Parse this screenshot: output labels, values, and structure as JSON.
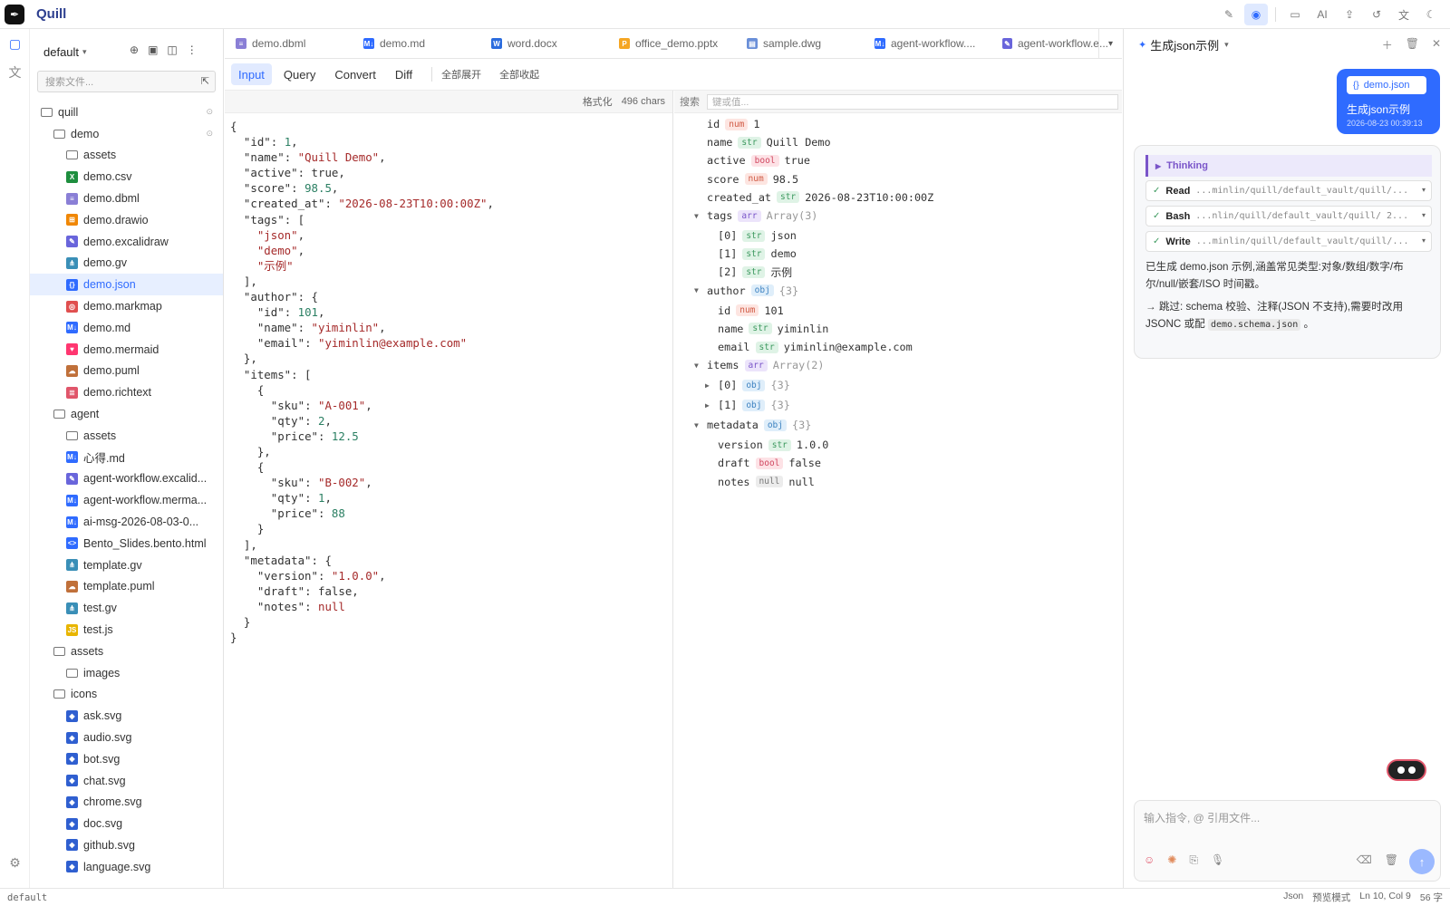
{
  "app": {
    "title": "Quill"
  },
  "topbar": {
    "actions": [
      {
        "name": "edit-icon",
        "glyph": "✎",
        "active": false
      },
      {
        "name": "preview-icon",
        "glyph": "◉",
        "active": true
      },
      {
        "name": "terminal-icon",
        "glyph": "▭",
        "active": false
      },
      {
        "name": "ai-icon",
        "glyph": "AI",
        "active": false
      },
      {
        "name": "share-icon",
        "glyph": "⇪",
        "active": false
      },
      {
        "name": "history-icon",
        "glyph": "↺",
        "active": false
      },
      {
        "name": "translate-icon",
        "glyph": "文",
        "active": false
      },
      {
        "name": "theme-icon",
        "glyph": "☾",
        "active": false
      }
    ]
  },
  "sidebar": {
    "vault": "default",
    "search_placeholder": "搜索文件...",
    "tree": [
      {
        "label": "quill",
        "depth": 0,
        "icon": "folder",
        "pin": true
      },
      {
        "label": "demo",
        "depth": 1,
        "icon": "folder",
        "pin": true
      },
      {
        "label": "assets",
        "depth": 2,
        "icon": "folder"
      },
      {
        "label": "demo.csv",
        "depth": 2,
        "icon": "csv"
      },
      {
        "label": "demo.dbml",
        "depth": 2,
        "icon": "dbml"
      },
      {
        "label": "demo.drawio",
        "depth": 2,
        "icon": "drawio"
      },
      {
        "label": "demo.excalidraw",
        "depth": 2,
        "icon": "excalidraw"
      },
      {
        "label": "demo.gv",
        "depth": 2,
        "icon": "gv"
      },
      {
        "label": "demo.json",
        "depth": 2,
        "icon": "json",
        "selected": true
      },
      {
        "label": "demo.markmap",
        "depth": 2,
        "icon": "markmap"
      },
      {
        "label": "demo.md",
        "depth": 2,
        "icon": "md"
      },
      {
        "label": "demo.mermaid",
        "depth": 2,
        "icon": "mermaid"
      },
      {
        "label": "demo.puml",
        "depth": 2,
        "icon": "puml"
      },
      {
        "label": "demo.richtext",
        "depth": 2,
        "icon": "richtext"
      },
      {
        "label": "agent",
        "depth": 1,
        "icon": "folder"
      },
      {
        "label": "assets",
        "depth": 2,
        "icon": "folder"
      },
      {
        "label": "心得.md",
        "depth": 2,
        "icon": "md"
      },
      {
        "label": "agent-workflow.excalid...",
        "depth": 2,
        "icon": "excalidraw"
      },
      {
        "label": "agent-workflow.merma...",
        "depth": 2,
        "icon": "md"
      },
      {
        "label": "ai-msg-2026-08-03-0...",
        "depth": 2,
        "icon": "md"
      },
      {
        "label": "Bento_Slides.bento.html",
        "depth": 2,
        "icon": "html"
      },
      {
        "label": "template.gv",
        "depth": 2,
        "icon": "gv"
      },
      {
        "label": "template.puml",
        "depth": 2,
        "icon": "puml"
      },
      {
        "label": "test.gv",
        "depth": 2,
        "icon": "gv"
      },
      {
        "label": "test.js",
        "depth": 2,
        "icon": "js"
      },
      {
        "label": "assets",
        "depth": 1,
        "icon": "folder"
      },
      {
        "label": "images",
        "depth": 2,
        "icon": "folder"
      },
      {
        "label": "icons",
        "depth": 1,
        "icon": "folder"
      },
      {
        "label": "ask.svg",
        "depth": 2,
        "icon": "svg"
      },
      {
        "label": "audio.svg",
        "depth": 2,
        "icon": "svg"
      },
      {
        "label": "bot.svg",
        "depth": 2,
        "icon": "svg"
      },
      {
        "label": "chat.svg",
        "depth": 2,
        "icon": "svg"
      },
      {
        "label": "chrome.svg",
        "depth": 2,
        "icon": "svg"
      },
      {
        "label": "doc.svg",
        "depth": 2,
        "icon": "svg"
      },
      {
        "label": "github.svg",
        "depth": 2,
        "icon": "svg"
      },
      {
        "label": "language.svg",
        "depth": 2,
        "icon": "svg"
      }
    ]
  },
  "icon_styles": {
    "folder": {
      "glyph": "",
      "color": "#777777"
    },
    "csv": {
      "glyph": "X",
      "color": "#1e8e3e"
    },
    "dbml": {
      "glyph": "≡",
      "color": "#8a7fd6"
    },
    "drawio": {
      "glyph": "⊞",
      "color": "#f08705"
    },
    "excalidraw": {
      "glyph": "✎",
      "color": "#6965db"
    },
    "gv": {
      "glyph": "⋔",
      "color": "#3a8fb7"
    },
    "json": {
      "glyph": "{}",
      "color": "#2f6bff"
    },
    "markmap": {
      "glyph": "◎",
      "color": "#e04f4f"
    },
    "md": {
      "glyph": "M↓",
      "color": "#2f6bff"
    },
    "mermaid": {
      "glyph": "♥",
      "color": "#ff3670"
    },
    "puml": {
      "glyph": "☁",
      "color": "#c0703a"
    },
    "richtext": {
      "glyph": "≣",
      "color": "#e0556a"
    },
    "html": {
      "glyph": "<>",
      "color": "#2f6bff"
    },
    "js": {
      "glyph": "JS",
      "color": "#e8b500"
    },
    "svg": {
      "glyph": "◆",
      "color": "#2f5fd0"
    },
    "docx": {
      "glyph": "W",
      "color": "#2b6cde"
    },
    "pptx": {
      "glyph": "P",
      "color": "#f5a623"
    },
    "dwg": {
      "glyph": "▤",
      "color": "#6a8fd8"
    }
  },
  "tabs": [
    {
      "label": "demo.dbml",
      "icon": "dbml"
    },
    {
      "label": "demo.md",
      "icon": "md"
    },
    {
      "label": "word.docx",
      "icon": "docx"
    },
    {
      "label": "office_demo.pptx",
      "icon": "pptx"
    },
    {
      "label": "sample.dwg",
      "icon": "dwg"
    },
    {
      "label": "agent-workflow....",
      "icon": "md"
    },
    {
      "label": "agent-workflow.e...",
      "icon": "excalidraw"
    }
  ],
  "modebar": {
    "modes": [
      "Input",
      "Query",
      "Convert",
      "Diff"
    ],
    "active": "Input",
    "expand_all": "全部展开",
    "collapse_all": "全部收起"
  },
  "input_pane": {
    "format_label": "格式化",
    "char_count": "496 chars",
    "code_lines": [
      [
        [
          "p",
          "{"
        ]
      ],
      [
        [
          "p",
          "  "
        ],
        [
          "k",
          "\"id\""
        ],
        [
          "p",
          ": "
        ],
        [
          "n",
          "1"
        ],
        [
          "p",
          ","
        ]
      ],
      [
        [
          "p",
          "  "
        ],
        [
          "k",
          "\"name\""
        ],
        [
          "p",
          ": "
        ],
        [
          "s",
          "\"Quill Demo\""
        ],
        [
          "p",
          ","
        ]
      ],
      [
        [
          "p",
          "  "
        ],
        [
          "k",
          "\"active\""
        ],
        [
          "p",
          ": "
        ],
        [
          "b",
          "true"
        ],
        [
          "p",
          ","
        ]
      ],
      [
        [
          "p",
          "  "
        ],
        [
          "k",
          "\"score\""
        ],
        [
          "p",
          ": "
        ],
        [
          "n",
          "98.5"
        ],
        [
          "p",
          ","
        ]
      ],
      [
        [
          "p",
          "  "
        ],
        [
          "k",
          "\"created_at\""
        ],
        [
          "p",
          ": "
        ],
        [
          "s",
          "\"2026-08-23T10:00:00Z\""
        ],
        [
          "p",
          ","
        ]
      ],
      [
        [
          "p",
          "  "
        ],
        [
          "k",
          "\"tags\""
        ],
        [
          "p",
          ": ["
        ]
      ],
      [
        [
          "p",
          "    "
        ],
        [
          "s",
          "\"json\""
        ],
        [
          "p",
          ","
        ]
      ],
      [
        [
          "p",
          "    "
        ],
        [
          "s",
          "\"demo\""
        ],
        [
          "p",
          ","
        ]
      ],
      [
        [
          "p",
          "    "
        ],
        [
          "s",
          "\"示例\""
        ]
      ],
      [
        [
          "p",
          "  ],"
        ]
      ],
      [
        [
          "p",
          "  "
        ],
        [
          "k",
          "\"author\""
        ],
        [
          "p",
          ": {"
        ]
      ],
      [
        [
          "p",
          "    "
        ],
        [
          "k",
          "\"id\""
        ],
        [
          "p",
          ": "
        ],
        [
          "n",
          "101"
        ],
        [
          "p",
          ","
        ]
      ],
      [
        [
          "p",
          "    "
        ],
        [
          "k",
          "\"name\""
        ],
        [
          "p",
          ": "
        ],
        [
          "s",
          "\"yiminlin\""
        ],
        [
          "p",
          ","
        ]
      ],
      [
        [
          "p",
          "    "
        ],
        [
          "k",
          "\"email\""
        ],
        [
          "p",
          ": "
        ],
        [
          "s",
          "\"yiminlin@example.com\""
        ]
      ],
      [
        [
          "p",
          "  },"
        ]
      ],
      [
        [
          "p",
          "  "
        ],
        [
          "k",
          "\"items\""
        ],
        [
          "p",
          ": ["
        ]
      ],
      [
        [
          "p",
          "    {"
        ]
      ],
      [
        [
          "p",
          "      "
        ],
        [
          "k",
          "\"sku\""
        ],
        [
          "p",
          ": "
        ],
        [
          "s",
          "\"A-001\""
        ],
        [
          "p",
          ","
        ]
      ],
      [
        [
          "p",
          "      "
        ],
        [
          "k",
          "\"qty\""
        ],
        [
          "p",
          ": "
        ],
        [
          "n",
          "2"
        ],
        [
          "p",
          ","
        ]
      ],
      [
        [
          "p",
          "      "
        ],
        [
          "k",
          "\"price\""
        ],
        [
          "p",
          ": "
        ],
        [
          "n",
          "12.5"
        ]
      ],
      [
        [
          "p",
          "    },"
        ]
      ],
      [
        [
          "p",
          "    {"
        ]
      ],
      [
        [
          "p",
          "      "
        ],
        [
          "k",
          "\"sku\""
        ],
        [
          "p",
          ": "
        ],
        [
          "s",
          "\"B-002\""
        ],
        [
          "p",
          ","
        ]
      ],
      [
        [
          "p",
          "      "
        ],
        [
          "k",
          "\"qty\""
        ],
        [
          "p",
          ": "
        ],
        [
          "n",
          "1"
        ],
        [
          "p",
          ","
        ]
      ],
      [
        [
          "p",
          "      "
        ],
        [
          "k",
          "\"price\""
        ],
        [
          "p",
          ": "
        ],
        [
          "n",
          "88"
        ]
      ],
      [
        [
          "p",
          "    }"
        ]
      ],
      [
        [
          "p",
          "  ],"
        ]
      ],
      [
        [
          "p",
          "  "
        ],
        [
          "k",
          "\"metadata\""
        ],
        [
          "p",
          ": {"
        ]
      ],
      [
        [
          "p",
          "    "
        ],
        [
          "k",
          "\"version\""
        ],
        [
          "p",
          ": "
        ],
        [
          "s",
          "\"1.0.0\""
        ],
        [
          "p",
          ","
        ]
      ],
      [
        [
          "p",
          "    "
        ],
        [
          "k",
          "\"draft\""
        ],
        [
          "p",
          ": "
        ],
        [
          "b",
          "false"
        ],
        [
          "p",
          ","
        ]
      ],
      [
        [
          "p",
          "    "
        ],
        [
          "k",
          "\"notes\""
        ],
        [
          "p",
          ": "
        ],
        [
          "s",
          "null"
        ]
      ],
      [
        [
          "p",
          "  }"
        ]
      ],
      [
        [
          "p",
          "}"
        ]
      ]
    ]
  },
  "tree_pane": {
    "search_label": "搜索",
    "search_placeholder": "键或值...",
    "rows": [
      {
        "depth": 0,
        "key": "id",
        "type": "num",
        "value": "1"
      },
      {
        "depth": 0,
        "key": "name",
        "type": "str",
        "value": "Quill Demo"
      },
      {
        "depth": 0,
        "key": "active",
        "type": "bool",
        "value": "true"
      },
      {
        "depth": 0,
        "key": "score",
        "type": "num",
        "value": "98.5"
      },
      {
        "depth": 0,
        "key": "created_at",
        "type": "str",
        "value": "2026-08-23T10:00:00Z"
      },
      {
        "depth": 0,
        "key": "tags",
        "type": "arr",
        "value": "Array(3)",
        "caret": "open"
      },
      {
        "depth": 1,
        "key": "[0]",
        "type": "str",
        "value": "json"
      },
      {
        "depth": 1,
        "key": "[1]",
        "type": "str",
        "value": "demo"
      },
      {
        "depth": 1,
        "key": "[2]",
        "type": "str",
        "value": "示例"
      },
      {
        "depth": 0,
        "key": "author",
        "type": "obj",
        "value": "{3}",
        "caret": "open"
      },
      {
        "depth": 1,
        "key": "id",
        "type": "num",
        "value": "101"
      },
      {
        "depth": 1,
        "key": "name",
        "type": "str",
        "value": "yiminlin"
      },
      {
        "depth": 1,
        "key": "email",
        "type": "str",
        "value": "yiminlin@example.com"
      },
      {
        "depth": 0,
        "key": "items",
        "type": "arr",
        "value": "Array(2)",
        "caret": "open"
      },
      {
        "depth": 1,
        "key": "[0]",
        "type": "obj",
        "value": "{3}",
        "caret": "closed"
      },
      {
        "depth": 1,
        "key": "[1]",
        "type": "obj",
        "value": "{3}",
        "caret": "closed"
      },
      {
        "depth": 0,
        "key": "metadata",
        "type": "obj",
        "value": "{3}",
        "caret": "open"
      },
      {
        "depth": 1,
        "key": "version",
        "type": "str",
        "value": "1.0.0"
      },
      {
        "depth": 1,
        "key": "draft",
        "type": "bool",
        "value": "false"
      },
      {
        "depth": 1,
        "key": "notes",
        "type": "null",
        "value": "null"
      }
    ]
  },
  "chat": {
    "title": "生成json示例",
    "user_message": {
      "file_chip": "demo.json",
      "text": "生成json示例",
      "time": "2026-08-23 00:39:13"
    },
    "thinking_label": "Thinking",
    "tools": [
      {
        "name": "Read",
        "arg": "...minlin/quill/default_vault/quill/..."
      },
      {
        "name": "Bash",
        "arg": "...nlin/quill/default_vault/quill/ 2..."
      },
      {
        "name": "Write",
        "arg": "...minlin/quill/default_vault/quill/..."
      }
    ],
    "reply_1": "已生成 demo.json 示例,涵盖常见类型:对象/数组/数字/布尔/null/嵌套/ISO 时间戳。",
    "reply_2_prefix": "→ 跳过: schema 校验、注释(JSON 不支持),需要时改用 JSONC 或配",
    "reply_2_code": "demo.schema.json",
    "reply_2_suffix": "。",
    "input_placeholder": "输入指令, @ 引用文件..."
  },
  "statusbar": {
    "left": "default",
    "lang": "Json",
    "mode": "预览模式",
    "cursor": "Ln 10, Col 9",
    "count": "56 字"
  }
}
